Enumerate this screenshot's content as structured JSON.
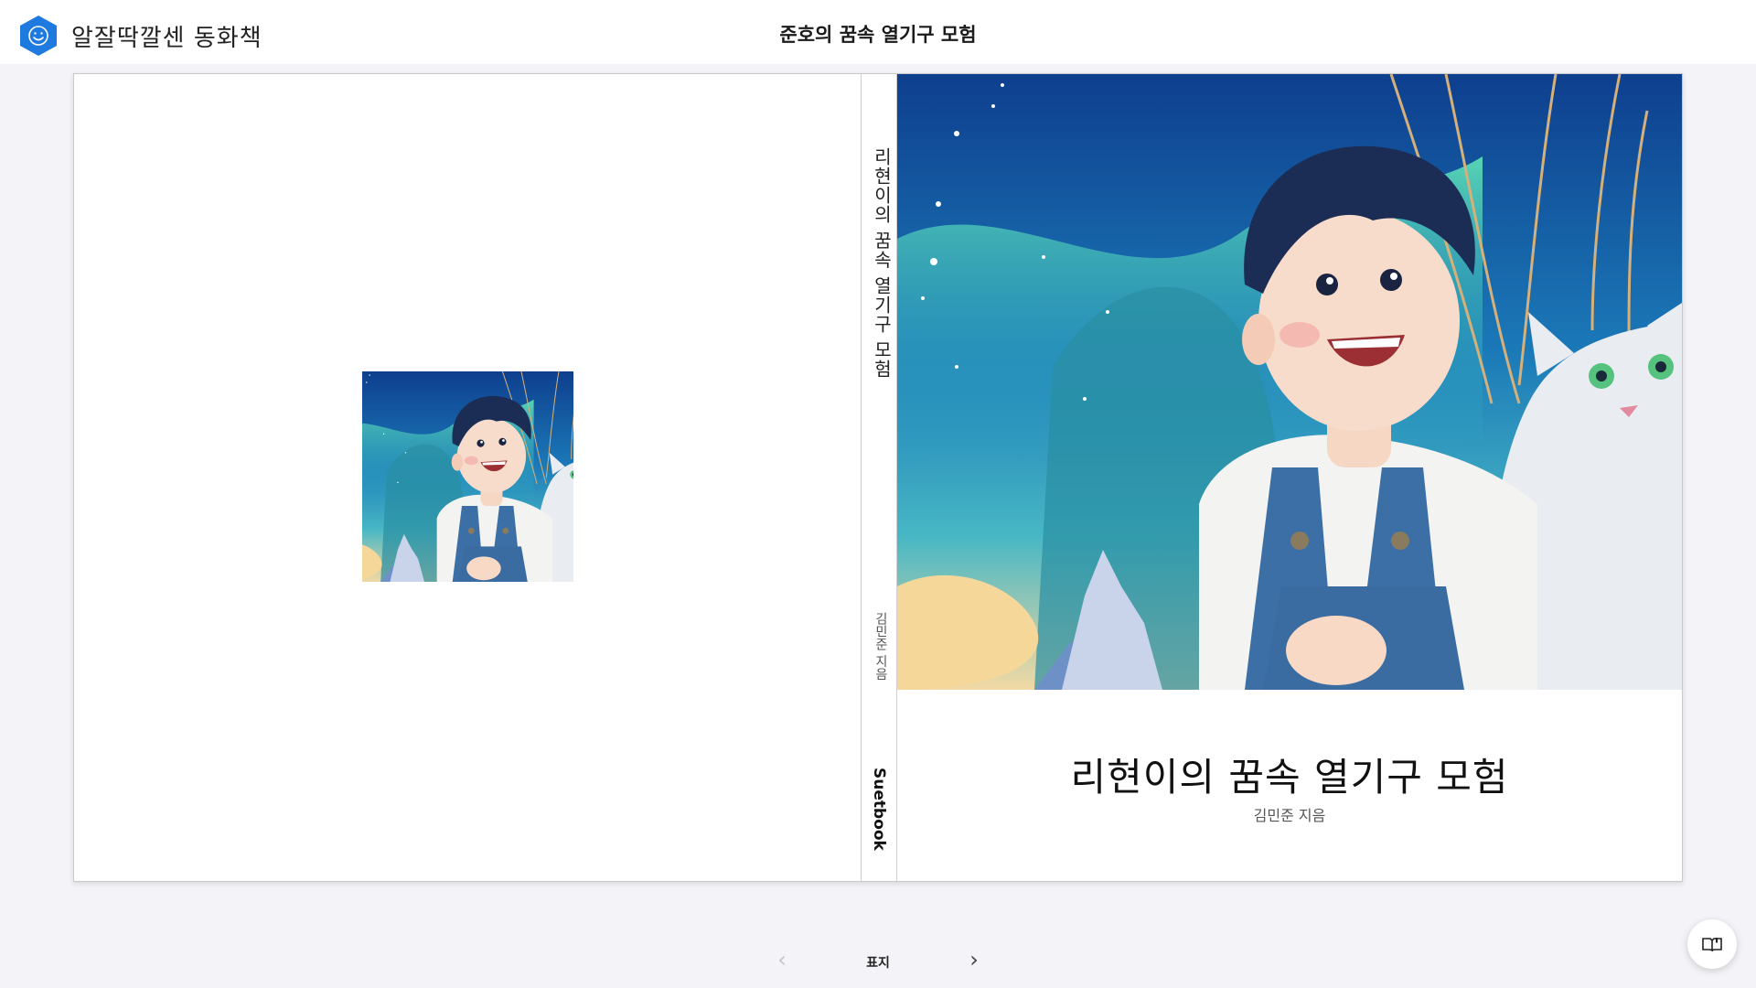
{
  "app": {
    "brand_name": "알잘딱깔센 동화책",
    "logo_icon": "smiley-hexagon-icon",
    "accent_color": "#1f7ae0"
  },
  "document": {
    "title": "준호의 꿈속 열기구 모험"
  },
  "book": {
    "spine": {
      "title": "리현이의 꿈속 열기구 모험",
      "author": "김민준 지음",
      "publisher": "Suetbook"
    },
    "front_cover": {
      "title": "리현이의 꿈속 열기구 모험",
      "author": "김민준 지음",
      "illustration": "boy-and-white-cat-in-hot-air-balloon-under-aurora"
    },
    "back_cover": {
      "illustration": "boy-and-white-cat-in-hot-air-balloon-under-aurora"
    }
  },
  "pager": {
    "prev_icon": "chevron-left-icon",
    "label": "표지",
    "next_icon": "chevron-right-icon"
  },
  "reader_button": {
    "icon": "open-book-icon"
  }
}
